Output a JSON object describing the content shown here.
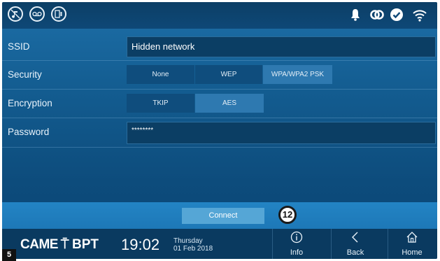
{
  "topbar": {
    "left_icons": [
      "mute-icon",
      "voicemail-icon",
      "door-lock-icon"
    ],
    "status_icons": [
      "bell-icon",
      "link-icon",
      "check-circle-icon",
      "wifi-icon"
    ]
  },
  "form": {
    "ssid_label": "SSID",
    "ssid_value": "Hidden network",
    "security_label": "Security",
    "security_options": [
      "None",
      "WEP",
      "WPA/WPA2 PSK"
    ],
    "security_selected": "WPA/WPA2 PSK",
    "encryption_label": "Encryption",
    "encryption_options": [
      "TKIP",
      "AES"
    ],
    "encryption_selected": "AES",
    "password_label": "Password",
    "password_value": "********"
  },
  "connect": {
    "label": "Connect",
    "callout": "12"
  },
  "bottombar": {
    "brand": "CAME",
    "brand_symbol": "⍑",
    "brand2": "BPT",
    "time": "19:02",
    "day": "Thursday",
    "date": "01 Feb 2018",
    "info_label": "Info",
    "back_label": "Back",
    "home_label": "Home"
  },
  "page_number": "5",
  "colors": {
    "accent": "#2e79b0",
    "topbar": "#0c3f66",
    "background": "#135c90"
  }
}
